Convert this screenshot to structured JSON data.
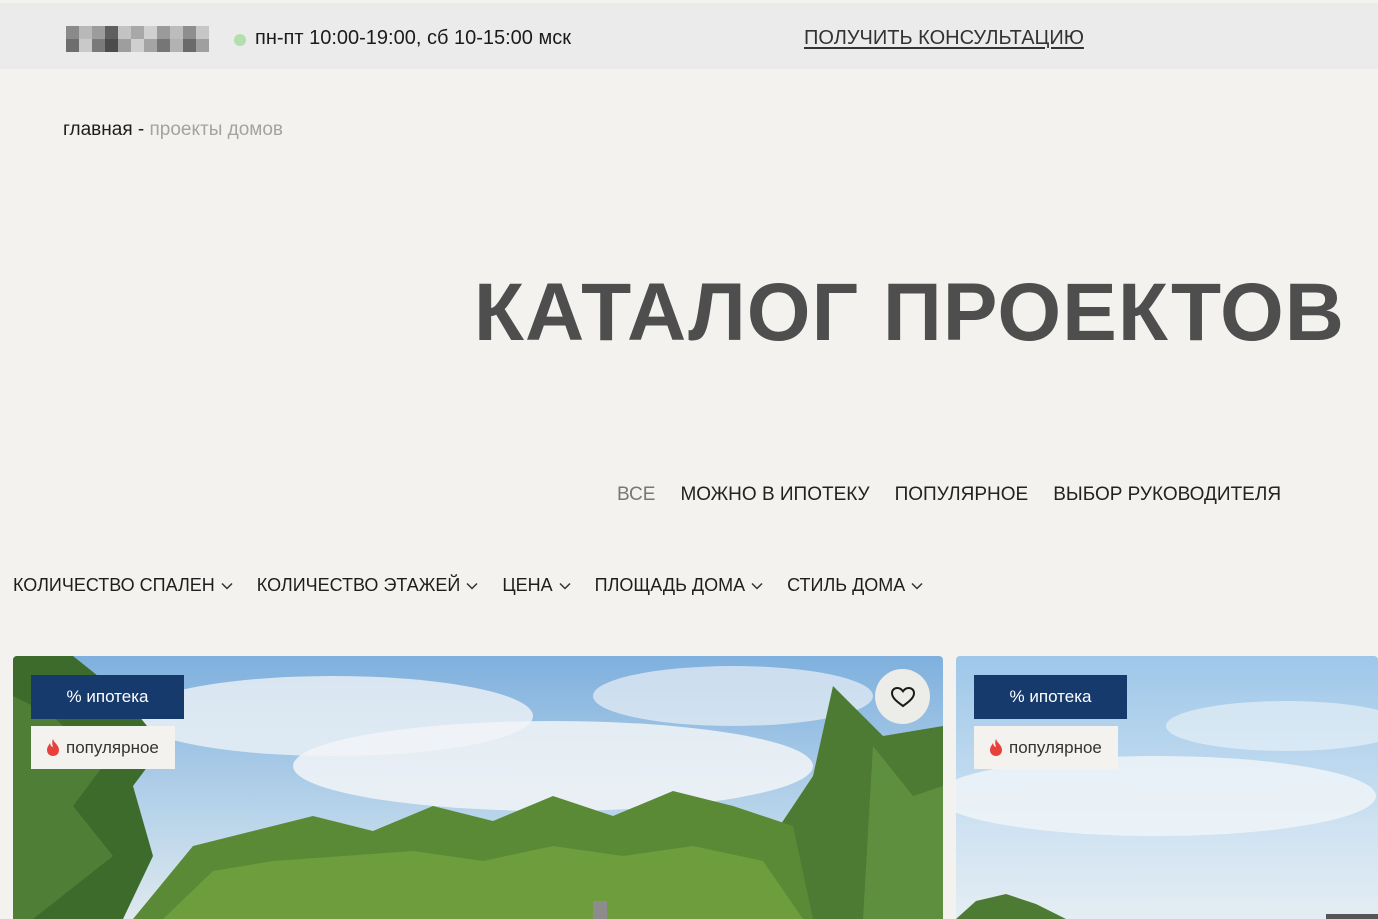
{
  "topbar": {
    "logo": "blurred-logo",
    "status_color": "#b3dfae",
    "hours": "пн-пт 10:00-19:00, сб 10-15:00 мск",
    "consult_link": "ПОЛУЧИТЬ КОНСУЛЬТАЦИЮ"
  },
  "breadcrumb": {
    "home": "главная",
    "separator": " - ",
    "current": "проекты домов"
  },
  "page_title": "КАТАЛОГ ПРОЕКТОВ",
  "tabs": [
    {
      "label": "ВСЕ",
      "active": true
    },
    {
      "label": "МОЖНО В ИПОТЕКУ"
    },
    {
      "label": "ПОПУЛЯРНОЕ"
    },
    {
      "label": "ВЫБОР РУКОВОДИТЕЛЯ"
    }
  ],
  "filters": [
    {
      "label": "КОЛИЧЕСТВО СПАЛЕН",
      "icon": "chevron-down-icon"
    },
    {
      "label": "КОЛИЧЕСТВО ЭТАЖЕЙ",
      "icon": "chevron-down-icon"
    },
    {
      "label": "ЦЕНА",
      "icon": "chevron-down-icon"
    },
    {
      "label": "ПЛОЩАДЬ ДОМА",
      "icon": "chevron-down-icon"
    },
    {
      "label": "СТИЛЬ ДОМА",
      "icon": "chevron-down-icon"
    }
  ],
  "cards": [
    {
      "badges": {
        "mortgage": "% ипотека",
        "popular": "популярное"
      },
      "icons": [
        "fire-icon",
        "heart-icon"
      ]
    },
    {
      "badges": {
        "mortgage": "% ипотека",
        "popular": "популярное"
      },
      "icons": [
        "fire-icon"
      ]
    }
  ],
  "colors": {
    "background": "#f3f2ee",
    "topbar": "#ebebeb",
    "badge_blue": "#173a6d",
    "title": "#4e4e4e",
    "fire": "#e8413c"
  }
}
